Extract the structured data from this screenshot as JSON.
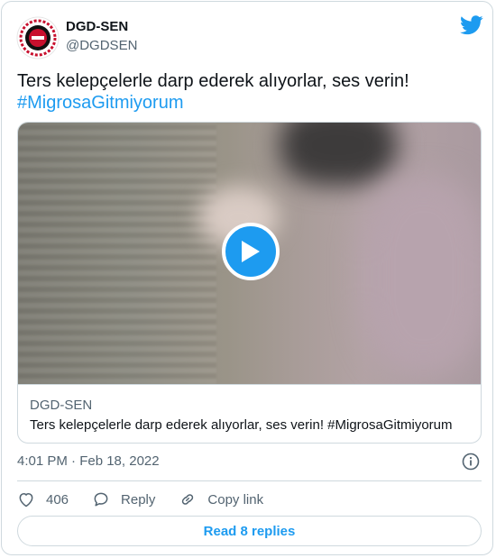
{
  "author": {
    "name": "DGD-SEN",
    "handle": "@DGDSEN",
    "avatar_icon": "dgd-sen-logo"
  },
  "tweet": {
    "text": "Ters kelepçelerle darp ederek alıyorlar, ses verin!",
    "hashtag": "#MigrosaGitmiyorum"
  },
  "media": {
    "type": "video",
    "play_icon": "play-icon",
    "card_title": "DGD-SEN",
    "card_description": "Ters kelepçelerle darp ederek alıyorlar, ses verin! #MigrosaGitmiyorum"
  },
  "meta": {
    "timestamp": "4:01 PM · Feb 18, 2022"
  },
  "actions": {
    "like_count": "406",
    "reply_label": "Reply",
    "copy_link_label": "Copy link"
  },
  "footer": {
    "read_replies_label": "Read 8 replies"
  },
  "colors": {
    "accent": "#1d9bf0",
    "text": "#0f1419",
    "muted": "#536471",
    "border": "#cfd9de"
  }
}
